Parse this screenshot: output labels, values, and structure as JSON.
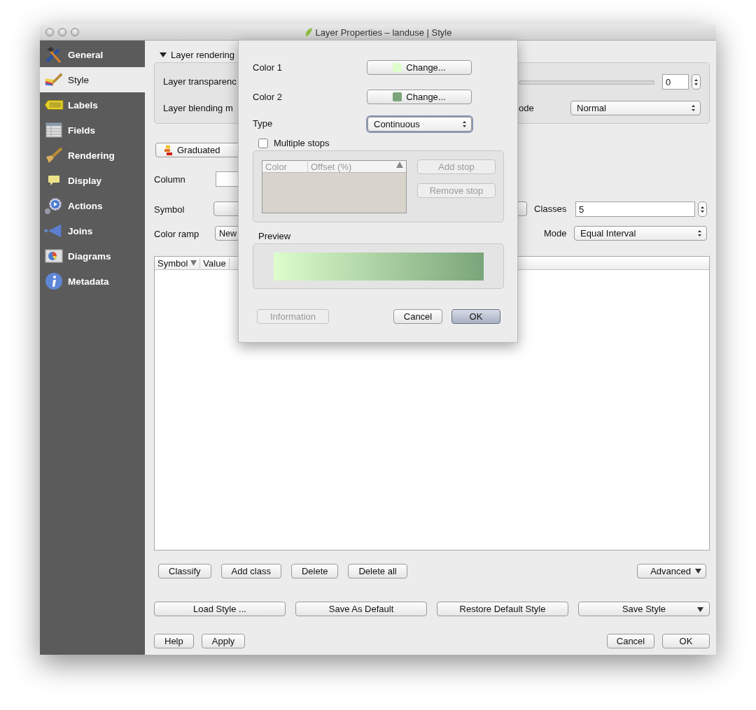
{
  "window": {
    "title": "Layer Properties – landuse | Style"
  },
  "sidebar": {
    "items": [
      {
        "label": "General",
        "kind": "tools",
        "selected": false
      },
      {
        "label": "Style",
        "kind": "paint",
        "selected": true
      },
      {
        "label": "Labels",
        "kind": "label",
        "selected": false
      },
      {
        "label": "Fields",
        "kind": "table",
        "selected": false
      },
      {
        "label": "Rendering",
        "kind": "brush",
        "selected": false
      },
      {
        "label": "Display",
        "kind": "bubble",
        "selected": false
      },
      {
        "label": "Actions",
        "kind": "gear",
        "selected": false
      },
      {
        "label": "Joins",
        "kind": "arrow",
        "selected": false
      },
      {
        "label": "Diagrams",
        "kind": "chart",
        "selected": false
      },
      {
        "label": "Metadata",
        "kind": "info",
        "selected": false
      }
    ]
  },
  "layer_rendering": {
    "title": "Layer rendering",
    "expanded": true,
    "transparency_label": "Layer transparenc",
    "transparency_value": "0",
    "blending_label": "Layer blending m",
    "feature_blending_label": "ode",
    "feature_blending_value": "Normal"
  },
  "renderer": {
    "type": "Graduated",
    "column_label": "Column",
    "symbol_label": "Symbol",
    "classes_label": "Classes",
    "classes_value": "5",
    "color_ramp_label": "Color ramp",
    "color_ramp_value": "New",
    "mode_label": "Mode",
    "mode_value": "Equal Interval"
  },
  "classes_table": {
    "columns": [
      "Symbol",
      "Value"
    ]
  },
  "class_buttons": [
    "Classify",
    "Add class",
    "Delete",
    "Delete all"
  ],
  "advanced_button": "Advanced",
  "style_buttons": [
    {
      "label": "Load Style ...",
      "menu": false
    },
    {
      "label": "Save As Default",
      "menu": false
    },
    {
      "label": "Restore Default Style",
      "menu": false
    },
    {
      "label": "Save Style",
      "menu": true
    }
  ],
  "footer": {
    "left": [
      "Help",
      "Apply"
    ],
    "right": [
      "Cancel",
      "OK"
    ]
  },
  "gradient_dialog": {
    "colors": [
      {
        "label": "Color 1",
        "button": "Change...",
        "color": "#ddfdcc"
      },
      {
        "label": "Color 2",
        "button": "Change...",
        "color": "#7aa57a"
      }
    ],
    "type_label": "Type",
    "type_value": "Continuous",
    "multiple_stops": {
      "label": "Multiple stops",
      "checked": false
    },
    "stops_table": {
      "columns": [
        "Color",
        "Offset (%)"
      ]
    },
    "stop_buttons": [
      {
        "label": "Add stop",
        "disabled": true
      },
      {
        "label": "Remove stop",
        "disabled": true
      }
    ],
    "preview_label": "Preview",
    "buttons": [
      {
        "label": "Information",
        "disabled": true,
        "default": false
      },
      {
        "label": "Cancel",
        "disabled": false,
        "default": false
      },
      {
        "label": "OK",
        "disabled": false,
        "default": true
      }
    ]
  }
}
